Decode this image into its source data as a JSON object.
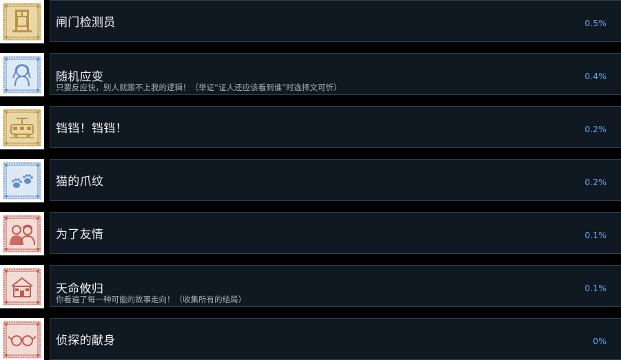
{
  "achievements": [
    {
      "title": "闸门检测员",
      "desc": "",
      "pct": "0.5%",
      "icon": "sluice-gate-icon",
      "theme": "gold"
    },
    {
      "title": "随机应变",
      "desc": "只要反应快，别人就跟不上我的逻辑！（举证“证人还应该看到谁”时选择文可忻）",
      "pct": "0.4%",
      "icon": "woman-portrait-icon",
      "theme": "blue"
    },
    {
      "title": "铛铛！铛铛！",
      "desc": "",
      "pct": "0.2%",
      "icon": "tram-icon",
      "theme": "gold"
    },
    {
      "title": "猫的爪纹",
      "desc": "",
      "pct": "0.2%",
      "icon": "paw-prints-icon",
      "theme": "blue"
    },
    {
      "title": "为了友情",
      "desc": "",
      "pct": "0.1%",
      "icon": "friendship-portrait-icon",
      "theme": "red"
    },
    {
      "title": "天命攸归",
      "desc": "你看遍了每一种可能的故事走向！（收集所有的结局）",
      "pct": "0.1%",
      "icon": "house-icon",
      "theme": "red"
    },
    {
      "title": "侦探的献身",
      "desc": "",
      "pct": "0%",
      "icon": "glasses-icon",
      "theme": "red"
    }
  ],
  "colors": {
    "gold": {
      "bg": "#e9d7a6",
      "line": "#b99245"
    },
    "blue": {
      "bg": "#dde9f5",
      "line": "#5e8fc7"
    },
    "red": {
      "bg": "#f1dcd6",
      "line": "#c8574e"
    },
    "card_bg": "#101822",
    "card_border": "#2b4150",
    "title": "#eef1f3",
    "desc": "#a8b0b6",
    "percent": "#62a7ea"
  }
}
